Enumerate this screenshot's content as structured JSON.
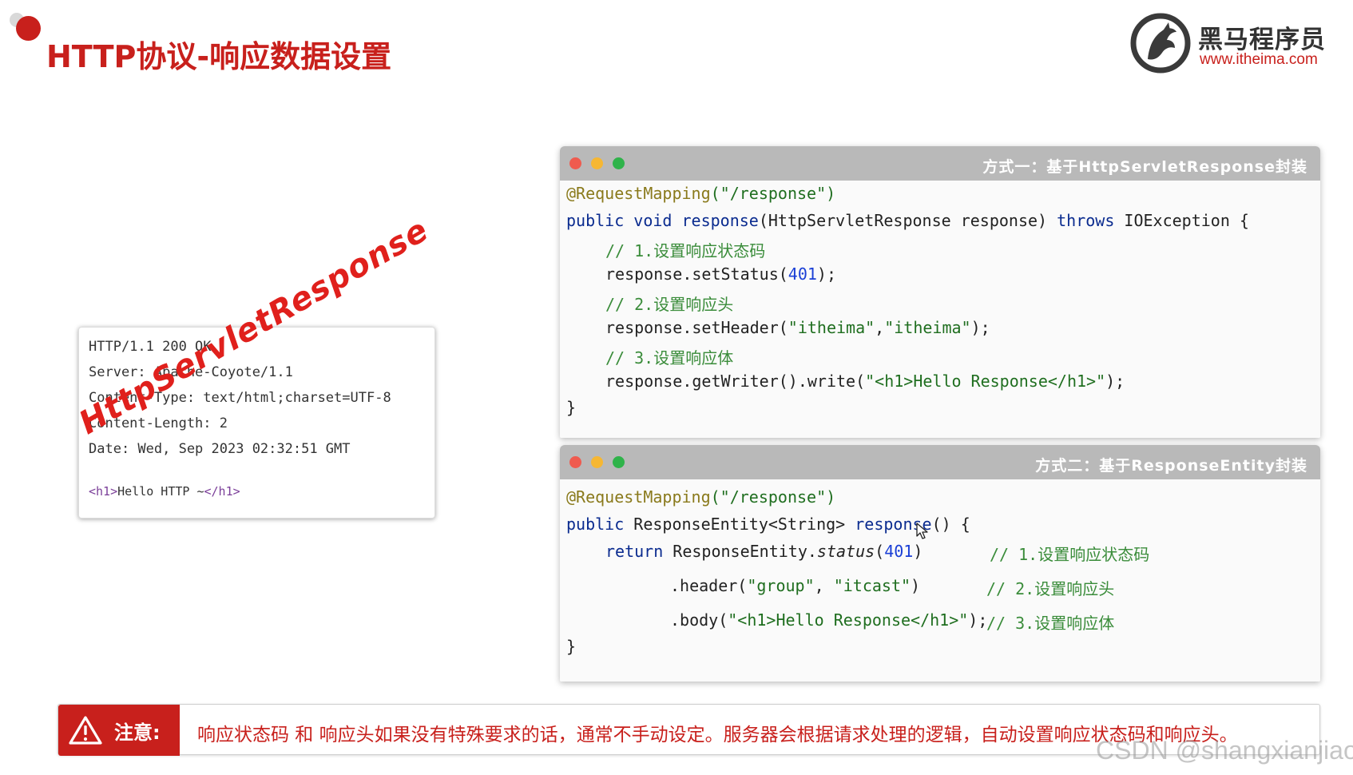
{
  "slide": {
    "title": "HTTP协议-响应数据设置"
  },
  "logo": {
    "name": "黑马程序员",
    "url": "www.itheima.com"
  },
  "http_response": {
    "lines": [
      "HTTP/1.1 200 OK",
      "Server: Apache-Coyote/1.1",
      "Content-Type: text/html;charset=UTF-8",
      "Content-Length: 2",
      "Date: Wed, Sep 2023 02:32:51 GMT"
    ],
    "body_tag_open": "<h1>",
    "body_text": "Hello HTTP ~",
    "body_tag_close": "</h1>"
  },
  "stamp": {
    "text": "HttpServletResponse"
  },
  "method_one": {
    "title": "方式一：基于HttpServletResponse封装",
    "annotation": "@RequestMapping",
    "annotation_arg": "(\"/response\")",
    "kw_public": "public",
    "kw_void": "void",
    "method_name": "response",
    "params": "(HttpServletResponse response)",
    "kw_throws": "throws",
    "exception": "IOException {",
    "comment_status": "// 1.设置响应状态码",
    "set_status_call": "response.setStatus(",
    "status_code": "401",
    "set_status_end": ");",
    "comment_header": "// 2.设置响应头",
    "set_header_call": "response.setHeader(",
    "header_key": "\"itheima\"",
    "header_sep": ",",
    "header_value": "\"itheima\"",
    "set_header_end": ");",
    "comment_body": "// 3.设置响应体",
    "write_call": "response.getWriter().write(",
    "write_arg": "\"<h1>Hello Response</h1>\"",
    "write_end": ");",
    "close_brace": "}"
  },
  "method_two": {
    "title": "方式二：基于ResponseEntity封装",
    "annotation": "@RequestMapping",
    "annotation_arg": "(\"/response\")",
    "kw_public": "public",
    "return_type": "ResponseEntity<String>",
    "method_name": "response",
    "method_end": "() {",
    "kw_return": "return",
    "entity_prefix": "ResponseEntity.",
    "status_method": "status",
    "status_open": "(",
    "status_code": "401",
    "status_close": ")",
    "comment_status": "// 1.设置响应状态码",
    "header_call": ".header(",
    "header_key": "\"group\"",
    "header_sep": ", ",
    "header_value": "\"itcast\"",
    "header_end": ")",
    "comment_header": "// 2.设置响应头",
    "body_call": ".body(",
    "body_arg": "\"<h1>Hello Response</h1>\"",
    "body_end": ");",
    "comment_body": "// 3.设置响应体",
    "close_brace": "}"
  },
  "notice": {
    "label": "注意:",
    "text": "响应状态码 和 响应头如果没有特殊要求的话，通常不手动设定。服务器会根据请求处理的逻辑，自动设置响应状态码和响应头。"
  },
  "watermark": {
    "text": "CSDN @shangxianjiao"
  },
  "colors": {
    "brand_red": "#c8201c",
    "keyword": "#0a2b8f",
    "string": "#1f6e1f",
    "comment": "#3a8c3a",
    "number": "#1a3fd6"
  },
  "icons": {
    "logo": "horse-logo-icon",
    "warning": "warning-triangle-icon",
    "cursor": "mouse-cursor-icon"
  }
}
